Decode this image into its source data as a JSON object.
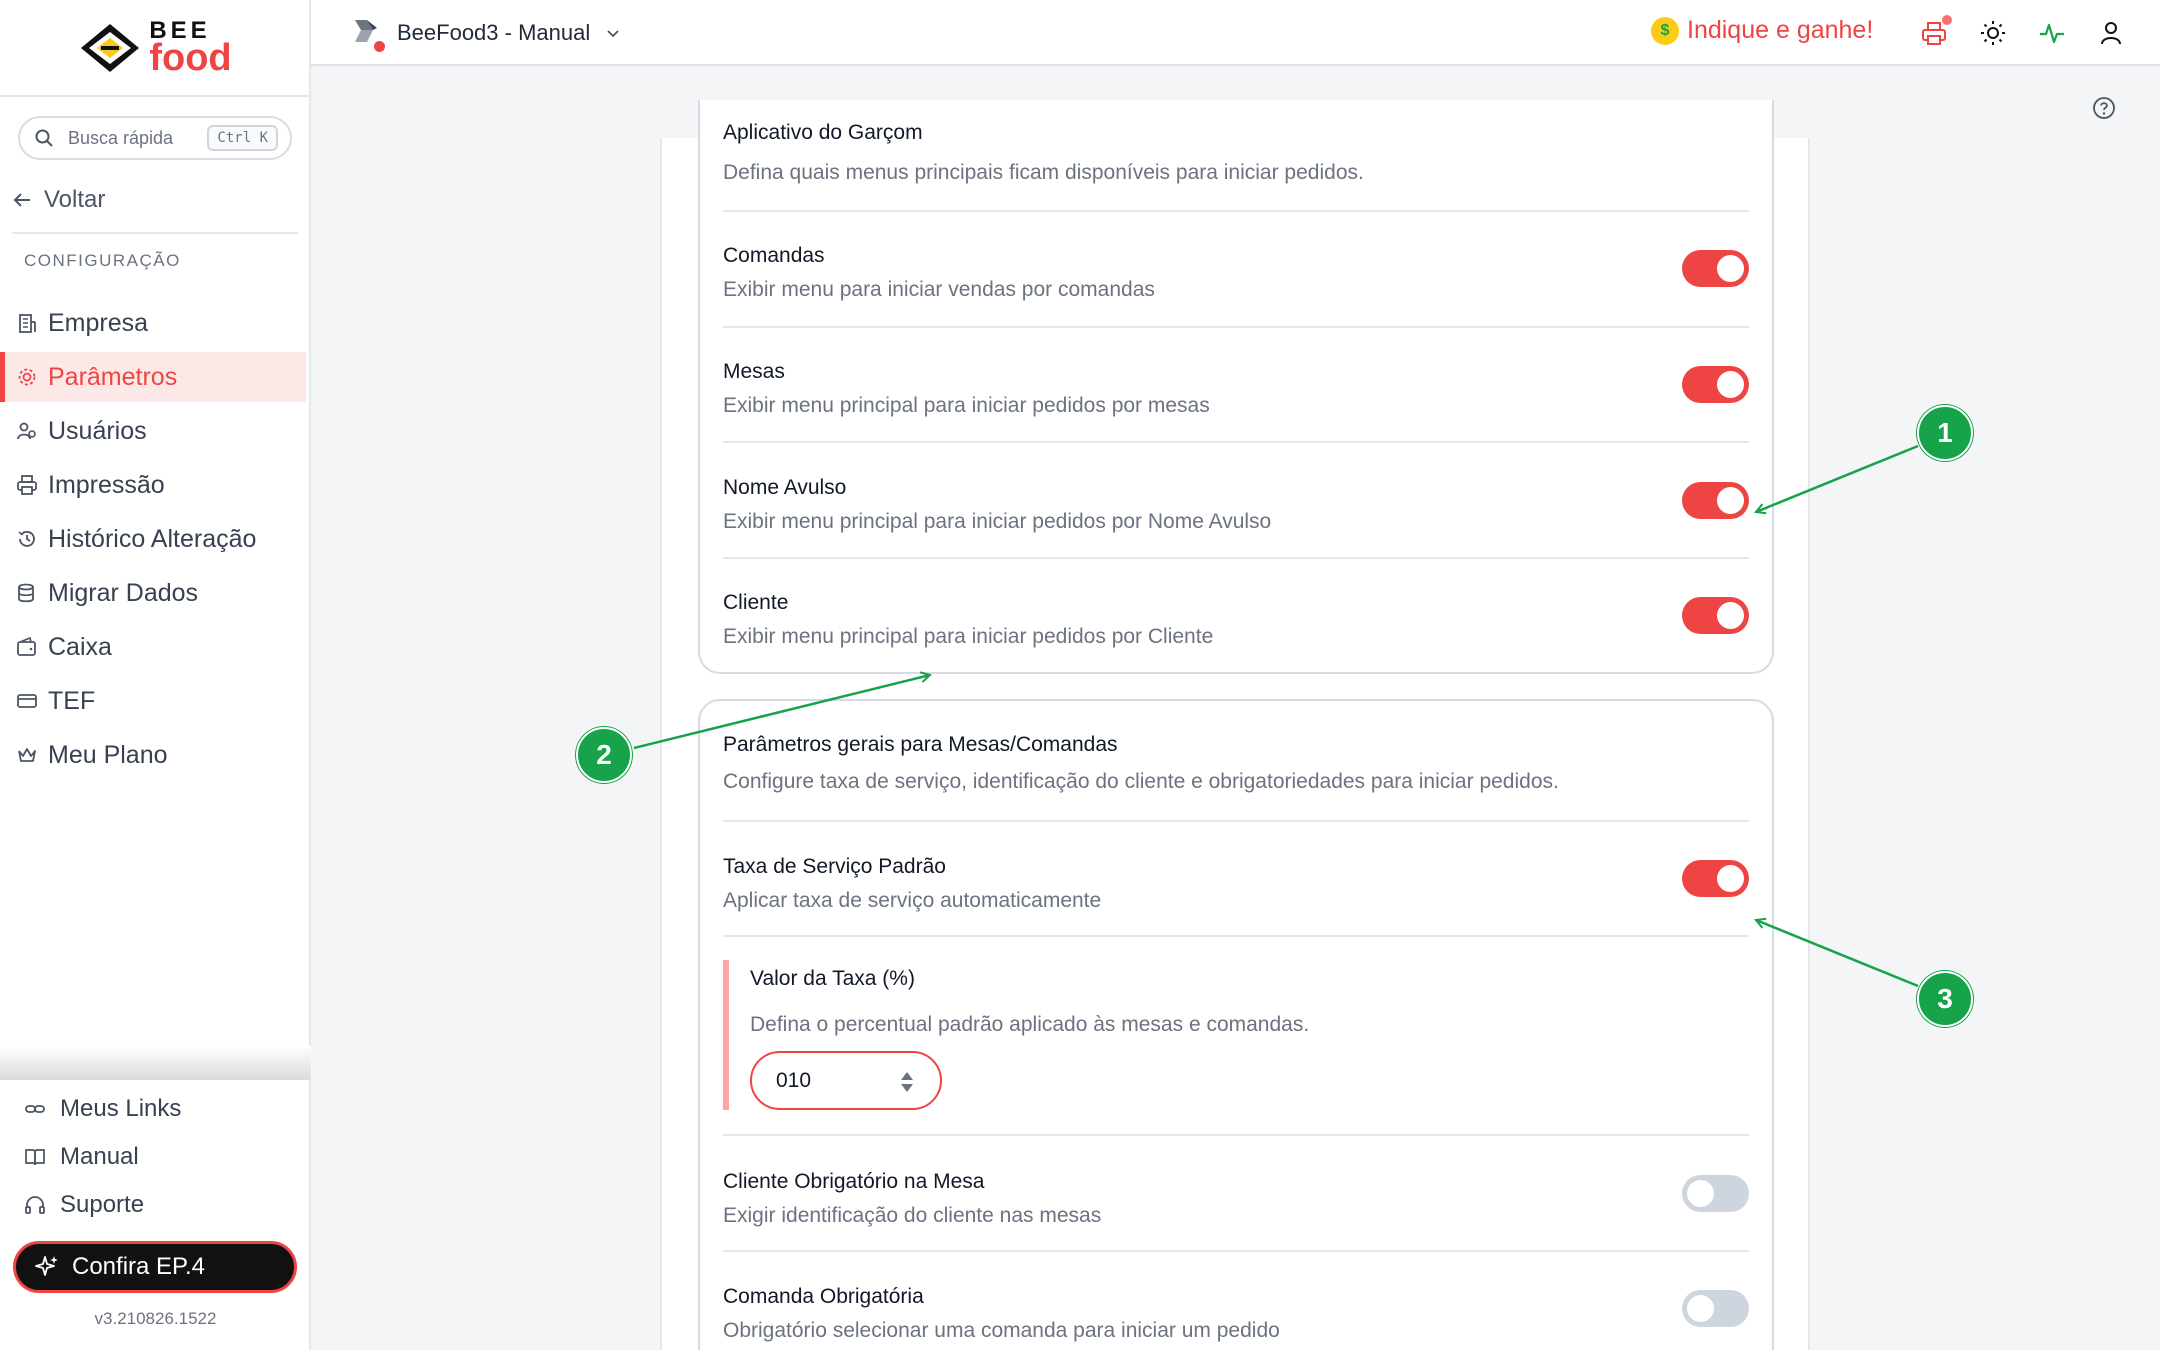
{
  "brand": {
    "logo_top": "BEE",
    "logo_bottom": "food"
  },
  "search": {
    "placeholder": "Busca rápida",
    "shortcut": "Ctrl K"
  },
  "sidebar": {
    "back_label": "Voltar",
    "section_label": "CONFIGURAÇÃO",
    "items": [
      {
        "label": "Empresa",
        "icon": "building-icon",
        "active": false
      },
      {
        "label": "Parâmetros",
        "icon": "gear-icon",
        "active": true
      },
      {
        "label": "Usuários",
        "icon": "users-icon",
        "active": false
      },
      {
        "label": "Impressão",
        "icon": "printer-icon",
        "active": false
      },
      {
        "label": "Histórico Alteração",
        "icon": "history-icon",
        "active": false
      },
      {
        "label": "Migrar Dados",
        "icon": "database-icon",
        "active": false
      },
      {
        "label": "Caixa",
        "icon": "wallet-icon",
        "active": false
      },
      {
        "label": "TEF",
        "icon": "card-icon",
        "active": false
      },
      {
        "label": "Meu Plano",
        "icon": "crown-icon",
        "active": false
      }
    ],
    "bottom_links": [
      {
        "label": "Meus Links",
        "icon": "link-icon"
      },
      {
        "label": "Manual",
        "icon": "book-icon"
      },
      {
        "label": "Suporte",
        "icon": "headset-icon"
      }
    ],
    "promo_label": "Confira EP.4",
    "version": "v3.210826.1522"
  },
  "topbar": {
    "company": "BeeFood3 - Manual",
    "referral": "Indique e ganhe!",
    "icons": [
      "printer-icon",
      "sun-icon",
      "activity-icon",
      "user-icon"
    ]
  },
  "settings": {
    "group1": {
      "header_title": "Aplicativo do Garçom",
      "header_desc": "Defina quais menus principais ficam disponíveis para iniciar pedidos.",
      "rows": [
        {
          "title": "Comandas",
          "desc": "Exibir menu para iniciar vendas por comandas",
          "enabled": true
        },
        {
          "title": "Mesas",
          "desc": "Exibir menu principal para iniciar pedidos por mesas",
          "enabled": true
        },
        {
          "title": "Nome Avulso",
          "desc": "Exibir menu principal para iniciar pedidos por Nome Avulso",
          "enabled": true
        },
        {
          "title": "Cliente",
          "desc": "Exibir menu principal para iniciar pedidos por Cliente",
          "enabled": true
        }
      ]
    },
    "group2": {
      "header_title": "Parâmetros gerais para Mesas/Comandas",
      "header_desc": "Configure taxa de serviço, identificação do cliente e obrigatoriedades para iniciar pedidos.",
      "service_fee": {
        "title": "Taxa de Serviço Padrão",
        "desc": "Aplicar taxa de serviço automaticamente",
        "enabled": true
      },
      "fee_value": {
        "title": "Valor da Taxa (%)",
        "desc": "Defina o percentual padrão aplicado às mesas e comandas.",
        "value": "010"
      },
      "rows": [
        {
          "title": "Cliente Obrigatório na Mesa",
          "desc": "Exigir identificação do cliente nas mesas",
          "enabled": false
        },
        {
          "title": "Comanda Obrigatória",
          "desc": "Obrigatório selecionar uma comanda para iniciar um pedido",
          "enabled": false
        }
      ]
    }
  },
  "annotations": [
    "1",
    "2",
    "3"
  ],
  "colors": {
    "accent": "#ef4444",
    "annotation": "#16a34a",
    "toggle_off": "#cfd5df"
  }
}
